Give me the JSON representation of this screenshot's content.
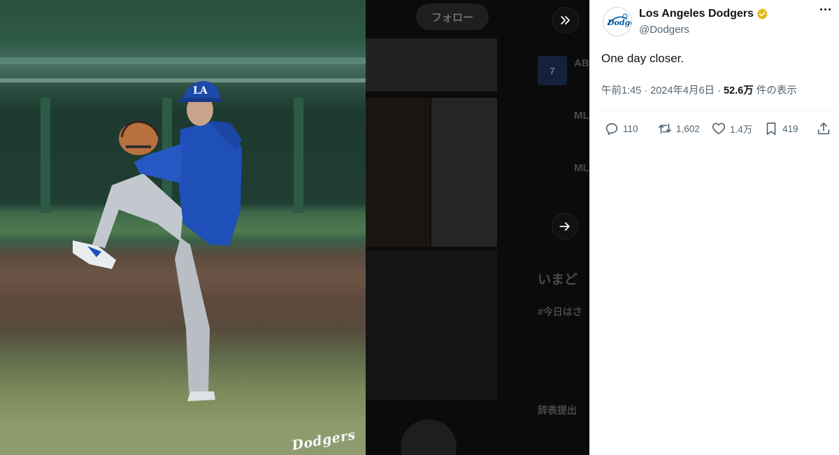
{
  "tweet": {
    "account": {
      "display_name": "Los Angeles Dodgers",
      "handle": "@Dodgers",
      "verified_icon": "verified-badge-icon",
      "avatar_icon": "dodgers-logo-icon"
    },
    "text": "One day closer.",
    "meta": {
      "time": "午前1:45",
      "separator": "·",
      "date": "2024年4月6日",
      "views": "52.6万",
      "views_label": "件の表示"
    },
    "actions": {
      "replies": "110",
      "reposts": "1,602",
      "likes": "1.4万",
      "bookmarks": "419"
    }
  },
  "media": {
    "watermark": "Dodgers"
  },
  "background": {
    "follow_label": "フォロー",
    "list_items": [
      {
        "title": "AB",
        "icon_text": "7"
      },
      {
        "title": "ML"
      },
      {
        "title": "ML"
      }
    ],
    "trending_heading": "いまど",
    "trend_tag": "#今日はさ",
    "trend_line": "辞表提出"
  },
  "colors": {
    "brand_blue": "#005a9c",
    "verified_gold": "#e2b719",
    "text_primary": "#0f1419",
    "text_secondary": "#536471"
  }
}
